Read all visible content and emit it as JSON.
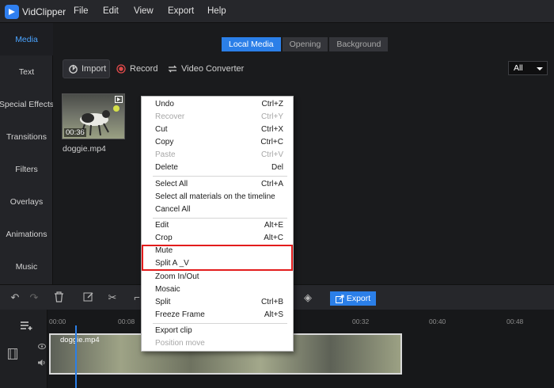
{
  "app": {
    "name": "VidClipper"
  },
  "menu": [
    "File",
    "Edit",
    "View",
    "Export",
    "Help"
  ],
  "sidebar": {
    "items": [
      {
        "label": "Media",
        "active": true
      },
      {
        "label": "Text"
      },
      {
        "label": "Special Effects"
      },
      {
        "label": "Transitions"
      },
      {
        "label": "Filters"
      },
      {
        "label": "Overlays"
      },
      {
        "label": "Animations"
      },
      {
        "label": "Music"
      }
    ]
  },
  "media_tabs": [
    {
      "label": "Local Media",
      "active": true
    },
    {
      "label": "Opening"
    },
    {
      "label": "Background"
    }
  ],
  "toolbar": {
    "import_label": "Import",
    "record_label": "Record",
    "converter_label": "Video Converter",
    "filter_value": "All"
  },
  "media_item": {
    "name": "doggie.mp4",
    "duration": "00:36"
  },
  "context_menu": {
    "items": [
      {
        "label": "Undo",
        "shortcut": "Ctrl+Z"
      },
      {
        "label": "Recover",
        "shortcut": "Ctrl+Y",
        "disabled": true
      },
      {
        "label": "Cut",
        "shortcut": "Ctrl+X"
      },
      {
        "label": "Copy",
        "shortcut": "Ctrl+C"
      },
      {
        "label": "Paste",
        "shortcut": "Ctrl+V",
        "disabled": true
      },
      {
        "label": "Delete",
        "shortcut": "Del"
      },
      {
        "separator": true
      },
      {
        "label": "Select All",
        "shortcut": "Ctrl+A"
      },
      {
        "label": "Select all materials on the timeline",
        "shortcut": ""
      },
      {
        "label": "Cancel All",
        "shortcut": ""
      },
      {
        "separator": true
      },
      {
        "label": "Edit",
        "shortcut": "Alt+E"
      },
      {
        "label": "Crop",
        "shortcut": "Alt+C"
      },
      {
        "label": "Mute",
        "shortcut": ""
      },
      {
        "label": "Split A _V",
        "shortcut": ""
      },
      {
        "label": "Zoom In/Out",
        "shortcut": ""
      },
      {
        "label": "Mosaic",
        "shortcut": ""
      },
      {
        "label": "Split",
        "shortcut": "Ctrl+B"
      },
      {
        "label": "Freeze Frame",
        "shortcut": "Alt+S"
      },
      {
        "separator": true
      },
      {
        "label": "Export clip",
        "shortcut": ""
      },
      {
        "label": "Position move",
        "shortcut": "",
        "disabled": true
      }
    ]
  },
  "timeline": {
    "export_label": "Export",
    "ruler": [
      "00:00",
      "00:08",
      "00:32",
      "00:40",
      "00:48"
    ],
    "clip_name": "doggie.mp4"
  },
  "colors": {
    "accent": "#2b7fe8",
    "highlight": "#e31c1c"
  }
}
